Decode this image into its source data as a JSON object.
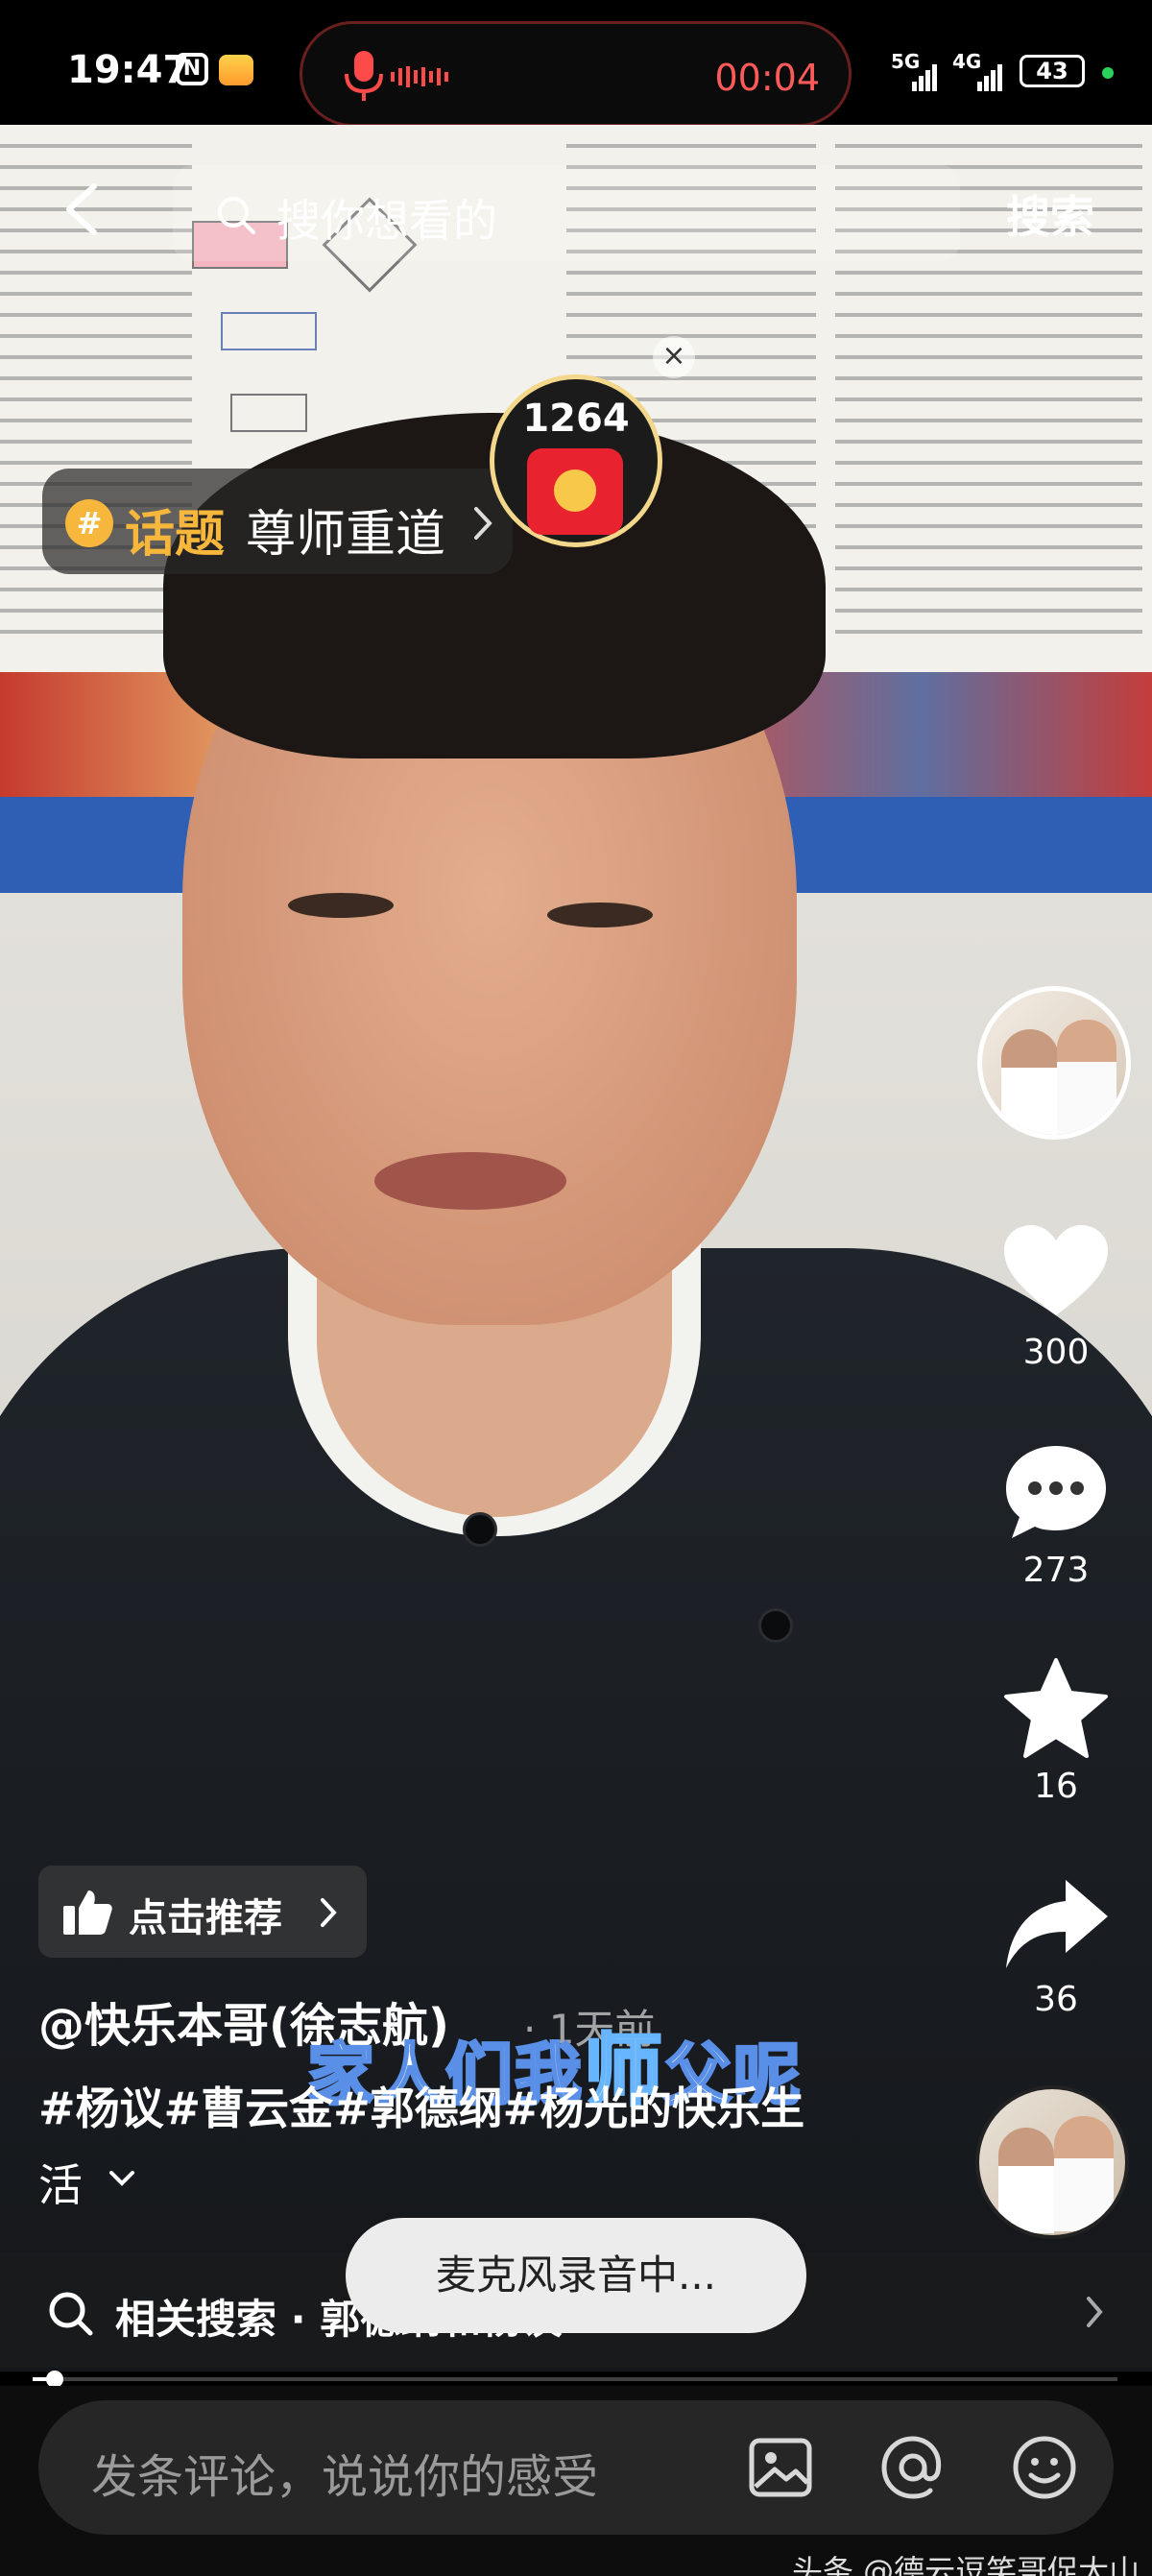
{
  "status_bar": {
    "time": "19:47",
    "nfc_icon": "N",
    "recording_time": "00:04",
    "network_1": "5G",
    "network_2": "4G",
    "battery": "43",
    "accent_red": "#ff5a5a",
    "dot_color": "#29d35a"
  },
  "top_bar": {
    "search_placeholder": "搜你想看的",
    "search_button": "搜索"
  },
  "topic": {
    "label": "话题",
    "text": "尊师重道"
  },
  "reward": {
    "count": "1264",
    "close": "×"
  },
  "actions": {
    "like_count": "300",
    "comment_count": "273",
    "favorite_count": "16",
    "share_count": "36"
  },
  "video_info": {
    "recommend_label": "点击推荐",
    "author": "@快乐本哥(徐志航)",
    "age": "· 1天前",
    "subtitle_pre": "家人们我",
    "subtitle_big": "师",
    "subtitle_post": "父呢",
    "desc_line1": "#杨议#曹云金#郭德纲#杨光的快乐生",
    "desc_line2": "活"
  },
  "related_search": {
    "text": "相关搜索 · 郭德纲和杨议"
  },
  "toast": {
    "text": "麦克风录音中..."
  },
  "progress": {
    "fraction": 0.02
  },
  "comment": {
    "placeholder": "发条评论，说说你的感受"
  },
  "watermark": {
    "text": "头条 @德云逗笑哥促大山"
  },
  "icons": {
    "back": "back-arrow-icon",
    "search": "search-icon",
    "like": "heart-icon",
    "comment": "comment-bubble-icon",
    "favorite": "star-icon",
    "share": "share-arrow-icon",
    "image": "image-icon",
    "mention": "at-icon",
    "emoji": "emoji-icon"
  }
}
